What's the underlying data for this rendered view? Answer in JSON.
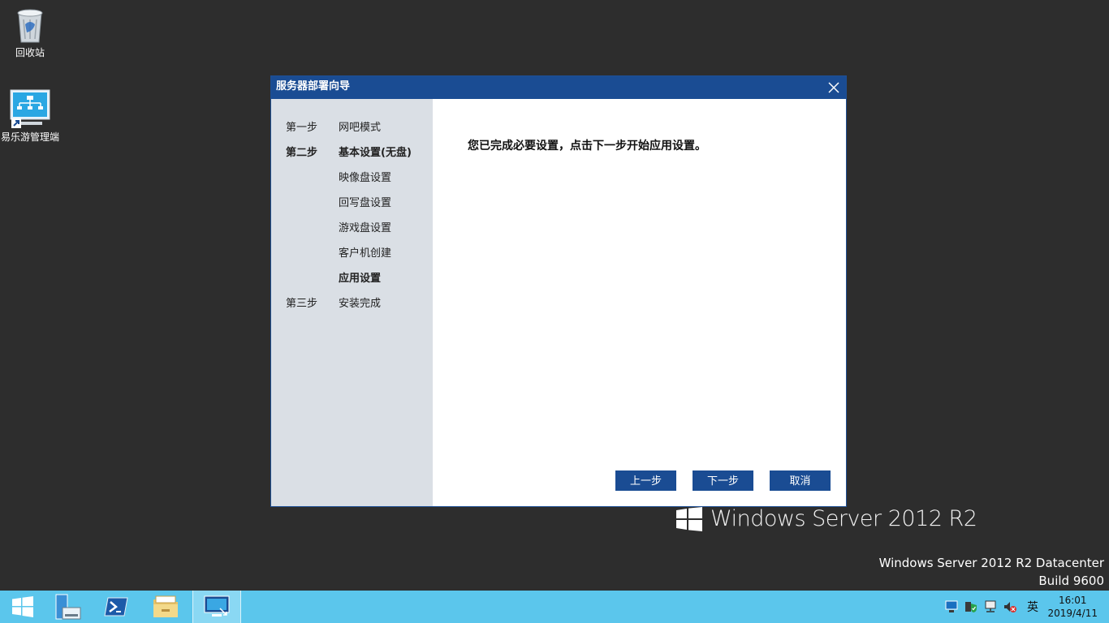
{
  "desktop": {
    "recycle_bin_label": "回收站",
    "manager_label": "易乐游管理端"
  },
  "branding": {
    "logo_text": "Windows Server 2012 R2",
    "edition": "Windows Server 2012 R2 Datacenter",
    "build": "Build 9600"
  },
  "dialog": {
    "title": "服务器部署向导",
    "message": "您已完成必要设置，点击下一步开始应用设置。",
    "steps": [
      {
        "key": "第一步",
        "label": "网吧模式"
      },
      {
        "key": "第二步",
        "label": "基本设置(无盘)"
      },
      {
        "key": "",
        "label": "映像盘设置"
      },
      {
        "key": "",
        "label": "回写盘设置"
      },
      {
        "key": "",
        "label": "游戏盘设置"
      },
      {
        "key": "",
        "label": "客户机创建"
      },
      {
        "key": "",
        "label": "应用设置"
      },
      {
        "key": "第三步",
        "label": "安装完成"
      }
    ],
    "buttons": {
      "prev": "上一步",
      "next": "下一步",
      "cancel": "取消"
    }
  },
  "taskbar": {
    "ime": "英",
    "time": "16:01",
    "date": "2019/4/11"
  },
  "colors": {
    "accent": "#1a4c93",
    "taskbar": "#5bc6ec",
    "desktop": "#2d2d2d"
  }
}
